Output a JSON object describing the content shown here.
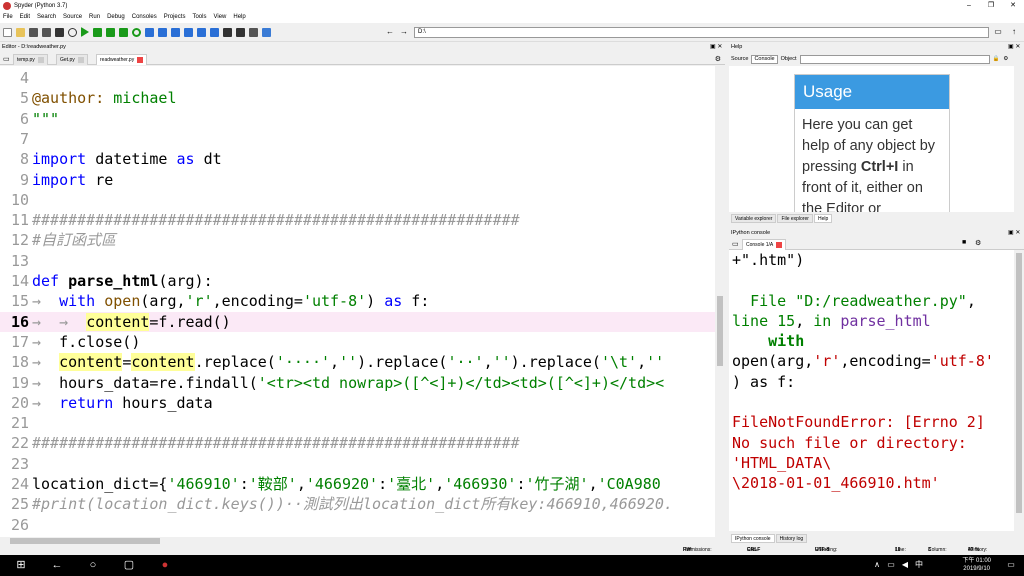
{
  "window": {
    "title": "Spyder (Python 3.7)"
  },
  "menu": [
    "File",
    "Edit",
    "Search",
    "Source",
    "Run",
    "Debug",
    "Consoles",
    "Projects",
    "Tools",
    "View",
    "Help"
  ],
  "toolbar": {
    "path": "D:\\"
  },
  "editor": {
    "title": "Editor - D:\\readweather.py",
    "tabs": [
      "temp.py",
      "Get.py",
      "readweather.py"
    ],
    "current_line": 16,
    "lines": [
      {
        "n": "4",
        "html": ""
      },
      {
        "n": "5",
        "html": "<span class=\"dec\">@author:</span> <span class=\"str\">michael</span>"
      },
      {
        "n": "6",
        "html": "<span class=\"str\">\"\"\"</span>"
      },
      {
        "n": "7",
        "html": ""
      },
      {
        "n": "8",
        "html": "<span class=\"kw\">import</span> datetime <span class=\"kw\">as</span> dt"
      },
      {
        "n": "9",
        "html": "<span class=\"kw\">import</span> re"
      },
      {
        "n": "10",
        "html": ""
      },
      {
        "n": "11",
        "html": "<span class=\"cm\">######################################################</span>"
      },
      {
        "n": "12",
        "html": "<span class=\"cm\">#自訂函式區</span>"
      },
      {
        "n": "13",
        "html": ""
      },
      {
        "n": "14",
        "html": "<span class=\"kw\">def</span> <span class=\"fn\">parse_html</span>(arg):"
      },
      {
        "n": "15",
        "html": "<span class=\"ar\">→</span>  <span class=\"kw\">with</span> <span class=\"dec\">open</span>(arg,<span class=\"str\">'r'</span>,encoding=<span class=\"str\">'utf-8'</span>) <span class=\"kw\">as</span> f:"
      },
      {
        "n": "16",
        "html": "<span class=\"ar\">→</span>  <span class=\"ar\">→</span>  <span class=\"hl\">content</span>=f.read()"
      },
      {
        "n": "17",
        "html": "<span class=\"ar\">→</span>  f.close()"
      },
      {
        "n": "18",
        "html": "<span class=\"ar\">→</span>  <span class=\"hl\">content</span>=<span class=\"hl\">content</span>.replace(<span class=\"str\">'····'</span>,<span class=\"str\">''</span>).replace(<span class=\"str\">'··'</span>,<span class=\"str\">''</span>).replace(<span class=\"str\">'\\t'</span>,<span class=\"str\">''</span>"
      },
      {
        "n": "19",
        "html": "<span class=\"ar\">→</span>  hours_data=re.findall(<span class=\"str\">'&lt;tr&gt;&lt;td nowrap&gt;([^&lt;]+)&lt;/td&gt;&lt;td&gt;([^&lt;]+)&lt;/td&gt;&lt;</span>"
      },
      {
        "n": "20",
        "html": "<span class=\"ar\">→</span>  <span class=\"kw\">return</span> hours_data"
      },
      {
        "n": "21",
        "html": ""
      },
      {
        "n": "22",
        "html": "<span class=\"cm\">######################################################</span>"
      },
      {
        "n": "23",
        "html": ""
      },
      {
        "n": "24",
        "html": "location_dict={<span class=\"str\">'466910'</span>:<span class=\"str\">'鞍部'</span>,<span class=\"str\">'466920'</span>:<span class=\"str\">'臺北'</span>,<span class=\"str\">'466930'</span>:<span class=\"str\">'竹子湖'</span>,<span class=\"str\">'C0A980</span>"
      },
      {
        "n": "25",
        "html": "<span class=\"cm\">#print(location_dict.keys())··測試列出location_dict所有key:466910,466920.</span>"
      },
      {
        "n": "26",
        "html": ""
      }
    ]
  },
  "help": {
    "title": "Help",
    "source_label": "Source",
    "source_value": "Console",
    "object_label": "Object",
    "card_title": "Usage",
    "card_body_1": "Here you can get help of any object by pressing ",
    "card_bold": "Ctrl+I",
    "card_body_2": " in front of it, either on the Editor or",
    "tabs": [
      "Variable explorer",
      "File explorer",
      "Help"
    ]
  },
  "console": {
    "title": "IPython console",
    "tab": "Console 1/A",
    "lines": [
      "+\".htm\")",
      "",
      "  File \"D:/readweather.py\",",
      "line 15, in parse_html",
      "    with",
      "open(arg,'r',encoding='utf-8'",
      ") as f:",
      "",
      "FileNotFoundError: [Errno 2]",
      "No such file or directory:",
      "'HTML_DATA\\",
      "\\2018-01-01_466910.htm'"
    ],
    "tabs": [
      "IPython console",
      "History log"
    ]
  },
  "status": {
    "permissions_label": "Permissions:",
    "permissions": "RW",
    "eol_label": "End-of-lines:",
    "eol": "CRLF",
    "encoding_label": "Encoding:",
    "encoding": "UTF-8",
    "line_label": "Line:",
    "line": "16",
    "col_label": "Column:",
    "col": "3",
    "mem_label": "Memory:",
    "mem": "47 %"
  },
  "taskbar": {
    "time": "下午 01:00",
    "date": "2019/9/10"
  },
  "colors": {
    "accent": "#3b9ae1",
    "current_line": "#fbe9f6"
  }
}
